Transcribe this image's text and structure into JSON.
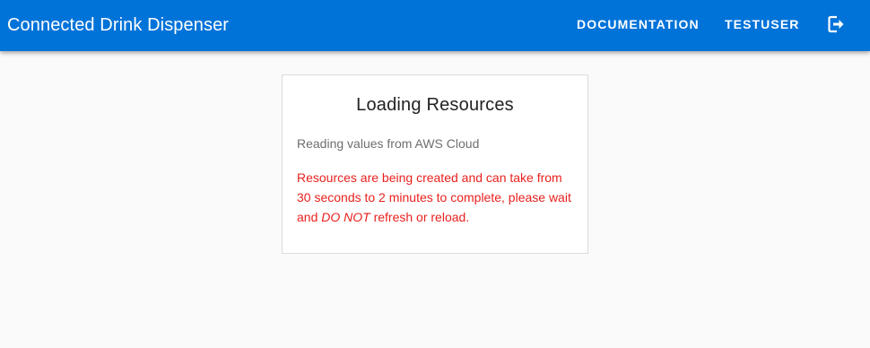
{
  "app": {
    "title": "Connected Drink Dispenser"
  },
  "nav": {
    "documentation_label": "DOCUMENTATION",
    "user_label": "TESTUSER",
    "logout_icon": "logout-icon"
  },
  "card": {
    "title": "Loading Resources",
    "subtitle": "Reading values from AWS Cloud",
    "warning_part1": "Resources are being created and can take from 30 seconds to 2 minutes to complete, please wait and ",
    "warning_emphasis": "DO NOT",
    "warning_part2": " refresh or reload."
  },
  "colors": {
    "appbar": "#0073d9",
    "warning": "#e8211e",
    "background": "#fafafa"
  }
}
